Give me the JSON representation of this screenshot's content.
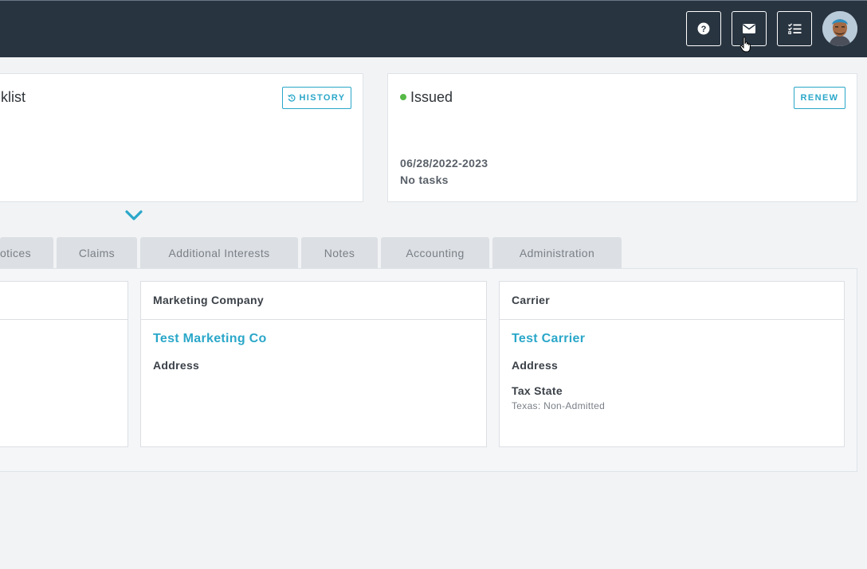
{
  "topbar": {
    "buttons": [
      {
        "name": "help-button",
        "icon": "question-circle-icon"
      },
      {
        "name": "mail-button",
        "icon": "envelope-icon"
      },
      {
        "name": "tasks-button",
        "icon": "checklist-icon"
      }
    ],
    "avatar": "user-avatar"
  },
  "checklist_card": {
    "title": "klist",
    "history_label": "HISTORY"
  },
  "status_card": {
    "status": "Issued",
    "status_color": "#56b947",
    "renew_label": "RENEW",
    "term": "06/28/2022-2023",
    "tasks": "No tasks"
  },
  "tabs": [
    {
      "label": "otices"
    },
    {
      "label": "Claims"
    },
    {
      "label": "Additional Interests"
    },
    {
      "label": "Notes"
    },
    {
      "label": "Accounting"
    },
    {
      "label": "Administration"
    }
  ],
  "marketing_company": {
    "heading": "Marketing Company",
    "name": "Test Marketing Co",
    "address_label": "Address"
  },
  "carrier": {
    "heading": "Carrier",
    "name": "Test Carrier",
    "address_label": "Address",
    "tax_state_label": "Tax State",
    "tax_state_value": "Texas: Non-Admitted"
  },
  "colors": {
    "topbar": "#283440",
    "accent": "#2aa7c9",
    "tab": "#dcdfe3"
  }
}
